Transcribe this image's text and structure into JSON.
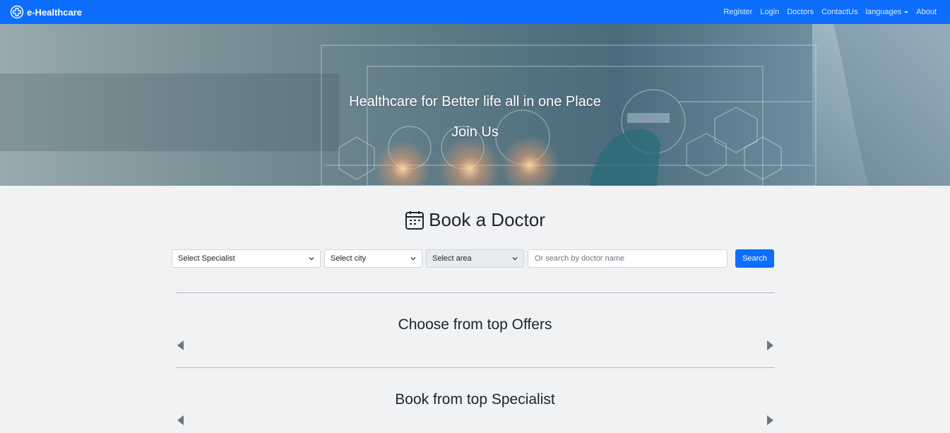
{
  "navbar": {
    "brand": "e-Healthcare",
    "links": {
      "register": "Register",
      "login": "Login",
      "doctors": "Doctors",
      "contact": "ContactUs",
      "languages": "languages",
      "about": "About"
    }
  },
  "hero": {
    "title": "Healthcare for Better life all in one Place",
    "join": "Join Us"
  },
  "booking": {
    "heading": "Book a Doctor",
    "specialist_select": "Select Specialist",
    "city_select": "Select city",
    "area_select": "Select area",
    "doctor_placeholder": "Or search by doctor name",
    "search_label": "Search"
  },
  "sections": {
    "offers_title": "Choose from top Offers",
    "specialist_title": "Book from top Specialist"
  },
  "colors": {
    "primary": "#0d6efd",
    "page_bg": "#f1f2f4"
  }
}
